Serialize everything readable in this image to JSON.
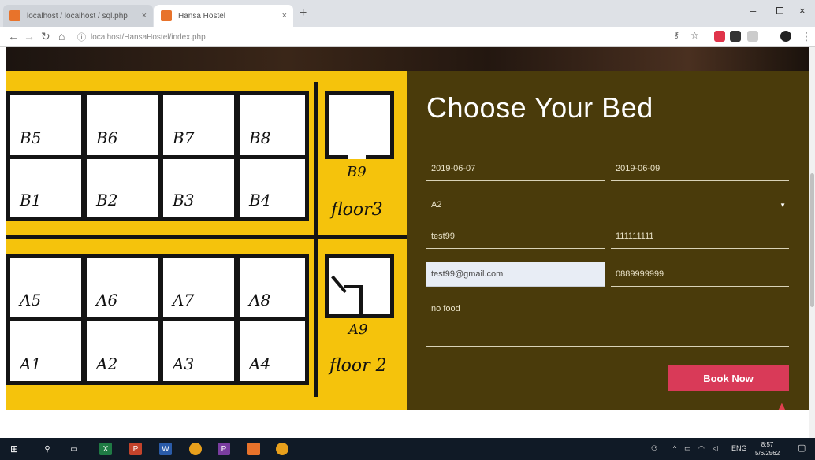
{
  "browser": {
    "tabs": [
      {
        "title": "localhost / localhost / sql.php"
      },
      {
        "title": "Hansa Hostel"
      }
    ],
    "tab_close": "×",
    "new_tab": "+",
    "url": "localhost/HansaHostel/index.php",
    "window_controls": {
      "minimize": "–",
      "maximize": "⧠",
      "close": "×"
    }
  },
  "floor_plan": {
    "floor3_label": "floor3",
    "floor2_label": "floor 2",
    "rooms_top": [
      "B5",
      "B6",
      "B7",
      "B8",
      "B1",
      "B2",
      "B3",
      "B4"
    ],
    "room_b9": "B9",
    "rooms_bottom": [
      "A5",
      "A6",
      "A7",
      "A8",
      "A1",
      "A2",
      "A3",
      "A4"
    ],
    "room_a9": "A9"
  },
  "booking": {
    "title": "Choose Your Bed",
    "check_in": "2019-06-07",
    "check_out": "2019-06-09",
    "bed_select": "A2",
    "name": "test99",
    "id_number": "111111111",
    "email": "test99@gmail.com",
    "phone": "0889999999",
    "note": "no food",
    "submit_label": "Book Now"
  },
  "taskbar": {
    "language": "ENG",
    "time": "8:57",
    "date": "5/6/2562"
  },
  "colors": {
    "plan_bg": "#f5c30c",
    "booking_bg": "#4a3b0b",
    "button_bg": "#d93a58"
  }
}
